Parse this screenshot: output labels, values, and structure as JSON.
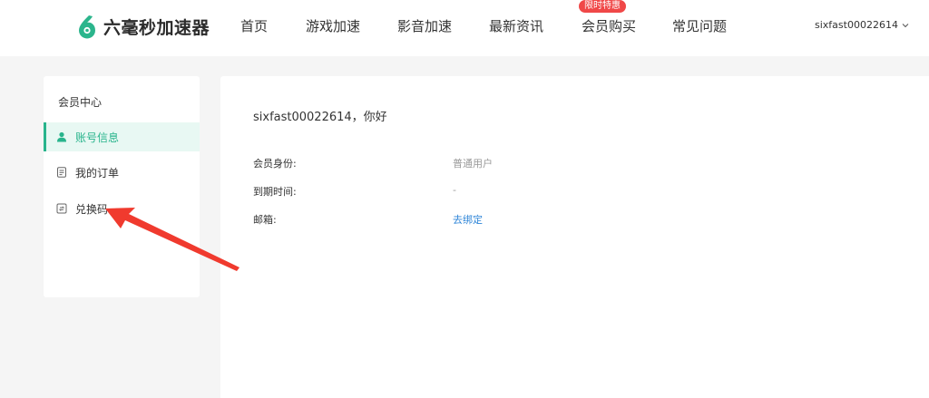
{
  "header": {
    "brand": "六毫秒加速器",
    "nav": [
      {
        "label": "首页"
      },
      {
        "label": "游戏加速"
      },
      {
        "label": "影音加速"
      },
      {
        "label": "最新资讯"
      },
      {
        "label": "会员购买"
      },
      {
        "label": "常见问题"
      }
    ],
    "promo_badge": "限时特惠",
    "username": "sixfast00022614"
  },
  "sidebar": {
    "title": "会员中心",
    "items": [
      {
        "label": "账号信息",
        "icon": "user-icon",
        "active": true
      },
      {
        "label": "我的订单",
        "icon": "order-icon",
        "active": false
      },
      {
        "label": "兑换码",
        "icon": "redeem-icon",
        "active": false
      }
    ]
  },
  "main": {
    "greeting": "sixfast00022614，你好",
    "rows": [
      {
        "label": "会员身份:",
        "value": "普通用户"
      },
      {
        "label": "到期时间:",
        "value": "-"
      },
      {
        "label": "邮箱:",
        "value": "去绑定"
      }
    ]
  },
  "colors": {
    "accent": "#28b48c",
    "active_bg": "#e8f8f3",
    "badge": "#f04848",
    "link": "#2f86d8",
    "annotation_arrow": "#f03a2e"
  }
}
